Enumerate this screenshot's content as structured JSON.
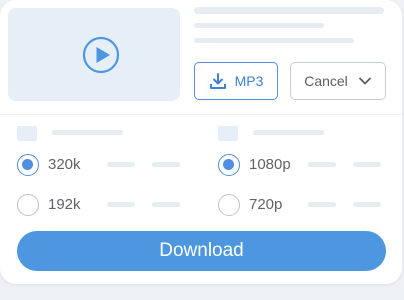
{
  "media": {
    "play_icon": "play-circle-icon"
  },
  "actions": {
    "mp3_label": "MP3",
    "mp3_icon": "download-icon",
    "cancel_label": "Cancel",
    "cancel_icon": "chevron-down-icon"
  },
  "audio_options": [
    {
      "label": "320k",
      "selected": true
    },
    {
      "label": "192k",
      "selected": false
    }
  ],
  "video_options": [
    {
      "label": "1080p",
      "selected": true
    },
    {
      "label": "720p",
      "selected": false
    }
  ],
  "download_label": "Download",
  "colors": {
    "accent": "#4d97e0",
    "placeholder": "#e7ecf3",
    "thumbnail_bg": "#e6eef8"
  }
}
